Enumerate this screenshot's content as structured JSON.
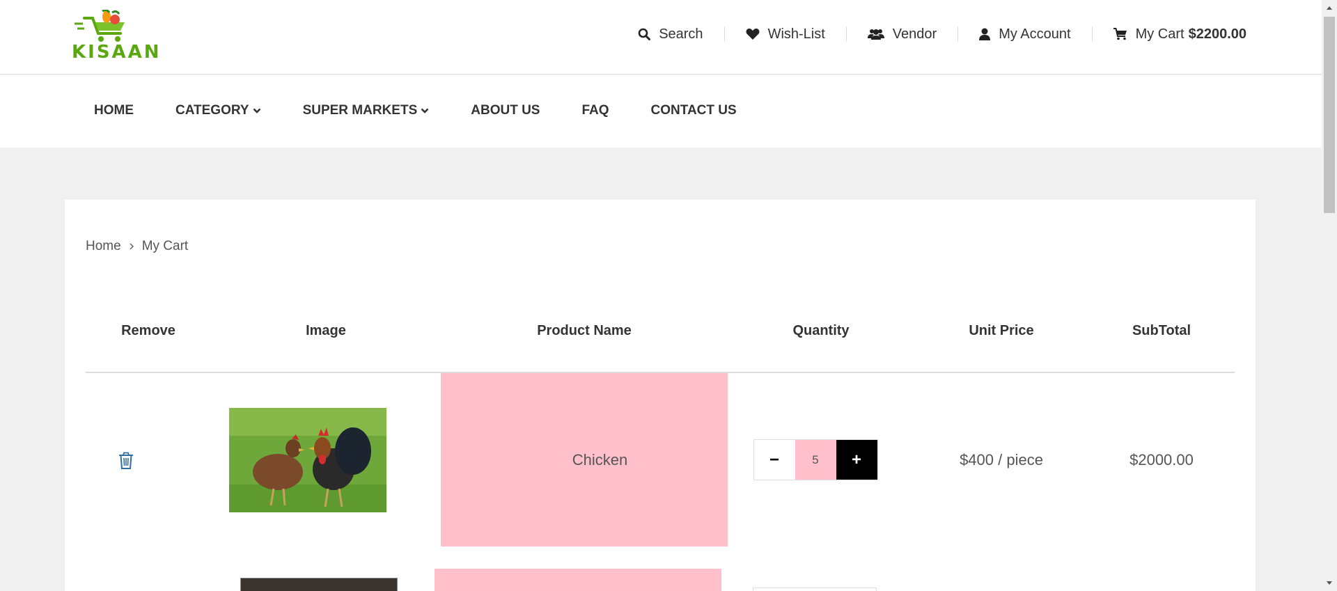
{
  "brand": {
    "name": "KISAAN"
  },
  "top_links": {
    "search": "Search",
    "wishlist": "Wish-List",
    "vendor": "Vendor",
    "account": "My Account",
    "cart_label": "My Cart",
    "cart_amount": "$2200.00"
  },
  "nav": {
    "home": "HOME",
    "category": "CATEGORY",
    "supermarkets": "SUPER MARKETS",
    "about": "ABOUT US",
    "faq": "FAQ",
    "contact": "CONTACT US"
  },
  "breadcrumb": {
    "home": "Home",
    "current": "My Cart"
  },
  "cart_table": {
    "headers": {
      "remove": "Remove",
      "image": "Image",
      "name": "Product Name",
      "quantity": "Quantity",
      "unit_price": "Unit Price",
      "subtotal": "SubTotal"
    },
    "rows": [
      {
        "name": "Chicken",
        "quantity": "5",
        "unit_price": "$400 / piece",
        "subtotal": "$2000.00",
        "image": "chickens-photo"
      }
    ]
  },
  "qty_controls": {
    "minus": "−",
    "plus": "+"
  },
  "colors": {
    "brand_green": "#5aa70f",
    "highlight_pink": "#ffc0cb",
    "accent_red": "#e74c3c",
    "trash_blue": "#2f6fa0"
  }
}
